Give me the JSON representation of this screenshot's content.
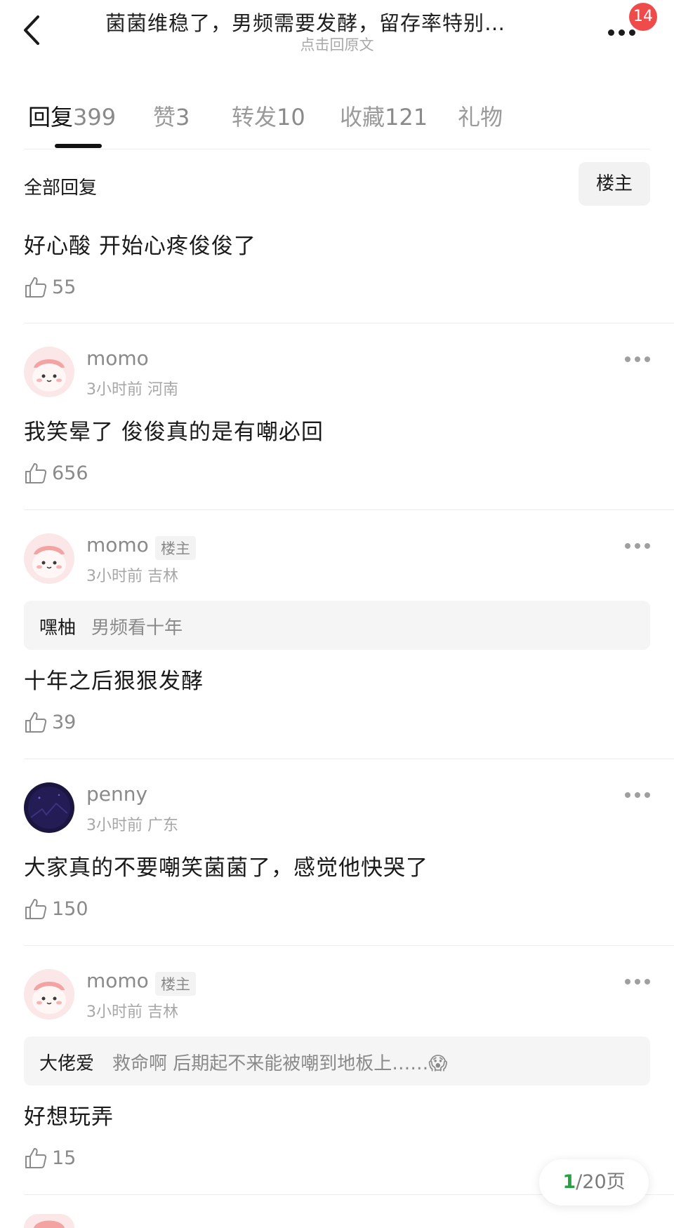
{
  "header": {
    "title": "菌菌维稳了，男频需要发酵，留存率特别…",
    "subtitle": "点击回原文",
    "badge": "14"
  },
  "tabs": [
    {
      "label": "回复",
      "count": "399"
    },
    {
      "label": "赞",
      "count": "3"
    },
    {
      "label": "转发",
      "count": "10"
    },
    {
      "label": "收藏",
      "count": "121"
    },
    {
      "label": "礼物",
      "count": ""
    }
  ],
  "filter": {
    "all_label": "全部回复",
    "op_label": "楼主"
  },
  "comments": [
    {
      "content": "好心酸 开始心疼俊俊了",
      "likes": "55"
    },
    {
      "user": "momo",
      "time": "3小时前",
      "location": "河南",
      "content": "我笑晕了 俊俊真的是有嘲必回",
      "likes": "656"
    },
    {
      "user": "momo",
      "op_tag": "楼主",
      "time": "3小时前",
      "location": "吉林",
      "quote_author": "嘿柚",
      "quote_text": "男频看十年",
      "content": "十年之后狠狠发酵",
      "likes": "39"
    },
    {
      "user": "penny",
      "time": "3小时前",
      "location": "广东",
      "content": "大家真的不要嘲笑菌菌了，感觉他快哭了",
      "likes": "150"
    },
    {
      "user": "momo",
      "op_tag": "楼主",
      "time": "3小时前",
      "location": "吉林",
      "quote_author": "大佬爱",
      "quote_text": "救命啊  后期起不来能被嘲到地板上……😱",
      "content": "好想玩弄",
      "likes": "15"
    }
  ],
  "pager": {
    "current": "1",
    "rest": "/20页"
  },
  "colors": {
    "badge": "#ef4b4b",
    "pager_current": "#2aa044",
    "text_muted": "#8a8a8a"
  },
  "icons": [
    "back-arrow-icon",
    "more-dots-icon",
    "thumbs-up-icon",
    "kebab-menu-icon"
  ]
}
